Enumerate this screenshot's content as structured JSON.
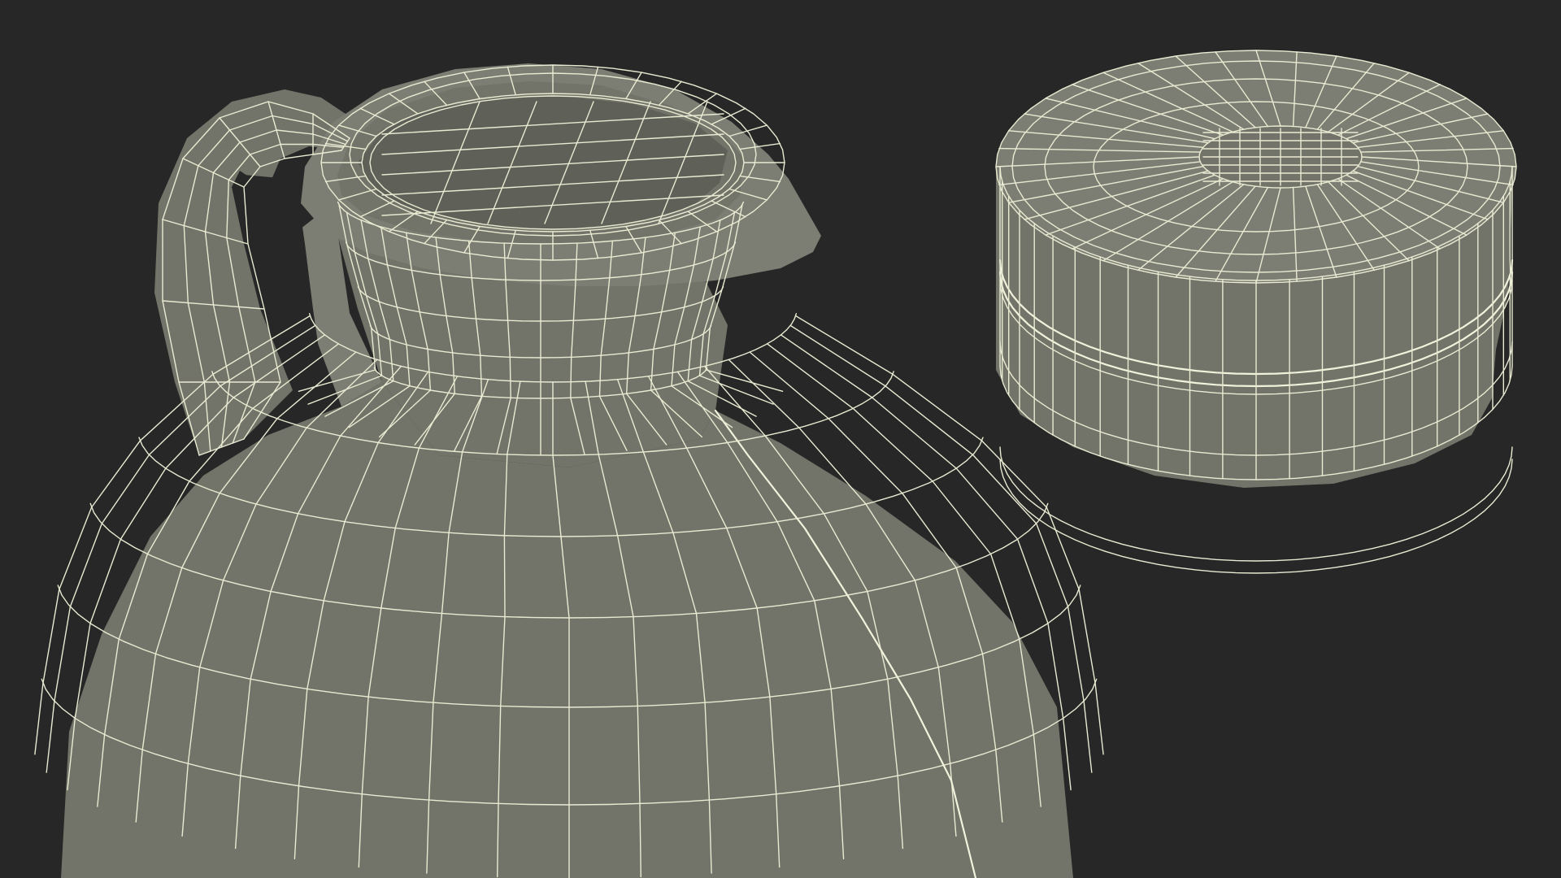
{
  "scene": {
    "background_color": "#272727",
    "mesh_color": "#737469",
    "wire_color": "#e9ead2"
  },
  "objects": [
    {
      "name": "jug",
      "view": "wireframe-over-shaded"
    },
    {
      "name": "cap",
      "view": "wireframe-over-shaded"
    }
  ]
}
